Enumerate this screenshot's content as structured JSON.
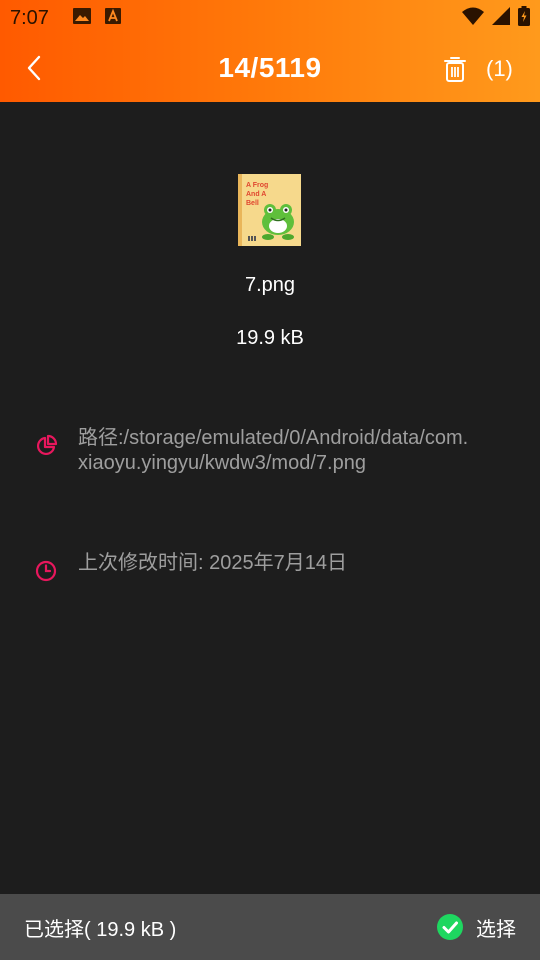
{
  "status_bar": {
    "time": "7:07"
  },
  "app_bar": {
    "title": "14/5119",
    "count": "(1)"
  },
  "file": {
    "name": "7.png",
    "size": "19.9 kB",
    "thumbnail_text": "A Frog And A Bell"
  },
  "info": {
    "path": "路径:/storage/emulated/0/Android/data/com.xiaoyu.yingyu/kwdw3/mod/7.png",
    "modified": "上次修改时间: 2025年7月14日"
  },
  "bottom_bar": {
    "selected": "已选择( 19.9 kB )",
    "select_label": "选择"
  },
  "colors": {
    "accent": "#ff6a00",
    "icon_pink": "#e8175d",
    "check_green": "#1ed760"
  }
}
